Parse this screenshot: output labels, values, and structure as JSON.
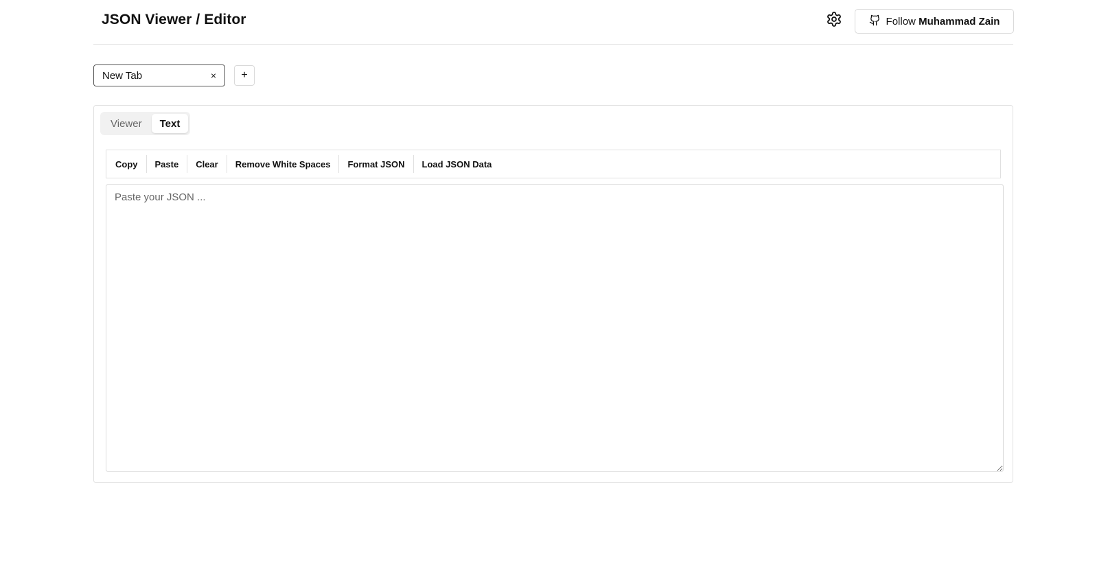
{
  "header": {
    "title": "JSON Viewer / Editor",
    "settings_icon": "gear-icon",
    "follow_prefix": "Follow",
    "follow_name": "Muhammad Zain",
    "follow_icon": "github-icon"
  },
  "tabs": {
    "items": [
      {
        "label": "New Tab",
        "close": "×"
      }
    ],
    "add_label": "+"
  },
  "mode": {
    "options": [
      {
        "label": "Viewer",
        "active": false
      },
      {
        "label": "Text",
        "active": true
      }
    ]
  },
  "toolbar": {
    "buttons": [
      "Copy",
      "Paste",
      "Clear",
      "Remove White Spaces",
      "Format JSON",
      "Load JSON Data"
    ]
  },
  "editor": {
    "value": "",
    "placeholder": "Paste your JSON ..."
  }
}
